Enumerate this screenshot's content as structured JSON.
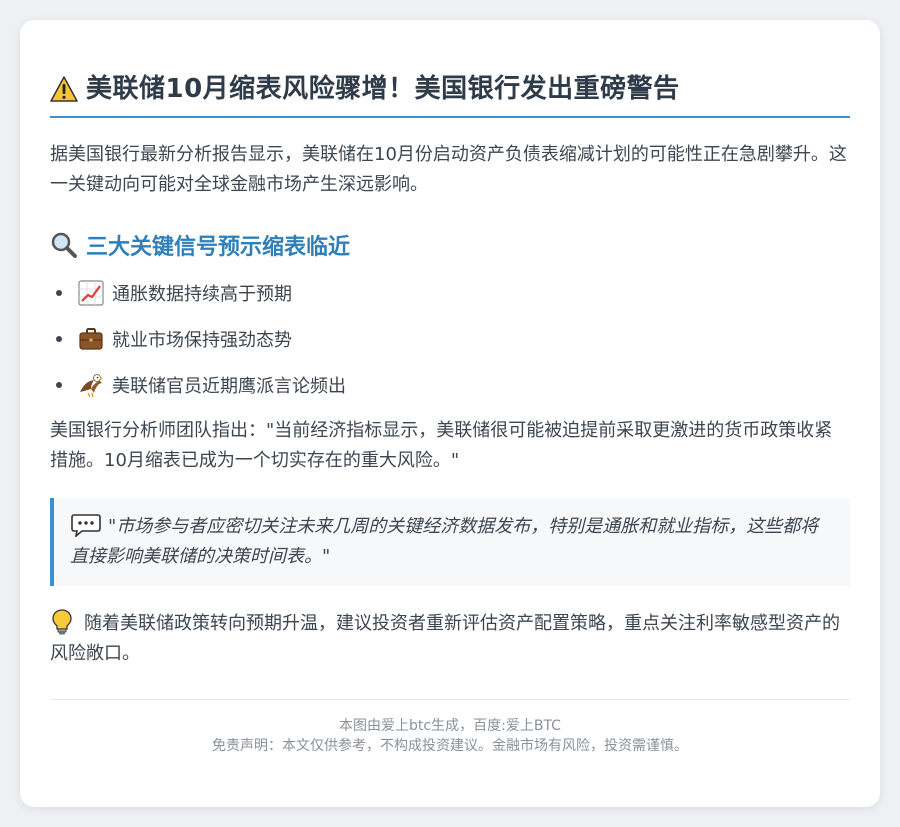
{
  "header": {
    "title": "美联储10月缩表风险骤增！美国银行发出重磅警告",
    "icon": "warning-icon"
  },
  "intro": "据美国银行最新分析报告显示，美联储在10月份启动资产负债表缩减计划的可能性正在急剧攀升。这一关键动向可能对全球金融市场产生深远影响。",
  "section": {
    "title": "三大关键信号预示缩表临近",
    "icon": "magnifier-icon"
  },
  "signals": [
    {
      "label": "通胀数据持续高于预期",
      "icon": "chart-up-icon"
    },
    {
      "label": "就业市场保持强劲态势",
      "icon": "briefcase-icon"
    },
    {
      "label": "美联储官员近期鹰派言论频出",
      "icon": "eagle-icon"
    }
  ],
  "analyst": "美国银行分析师团队指出：\"当前经济指标显示，美联储很可能被迫提前采取更激进的货币政策收紧措施。10月缩表已成为一个切实存在的重大风险。\"",
  "quote": {
    "text": "\"市场参与者应密切关注未来几周的关键经济数据发布，特别是通胀和就业指标，这些都将直接影响美联储的决策时间表。\"",
    "icon": "speech-bubble-icon"
  },
  "tip": {
    "text": "随着美联储政策转向预期升温，建议投资者重新评估资产配置策略，重点关注利率敏感型资产的风险敞口。",
    "icon": "lightbulb-icon"
  },
  "footer": {
    "credit": "本图由爱上btc生成，百度:爱上BTC",
    "disclaimer": "免责声明：本文仅供参考，不构成投资建议。金融市场有风险，投资需谨慎。"
  },
  "colors": {
    "accent": "#3c8fd0",
    "section_title": "#2f7fb8",
    "title": "#2f3b48",
    "body_text": "#3d4650",
    "footer_text": "#8a9199"
  }
}
